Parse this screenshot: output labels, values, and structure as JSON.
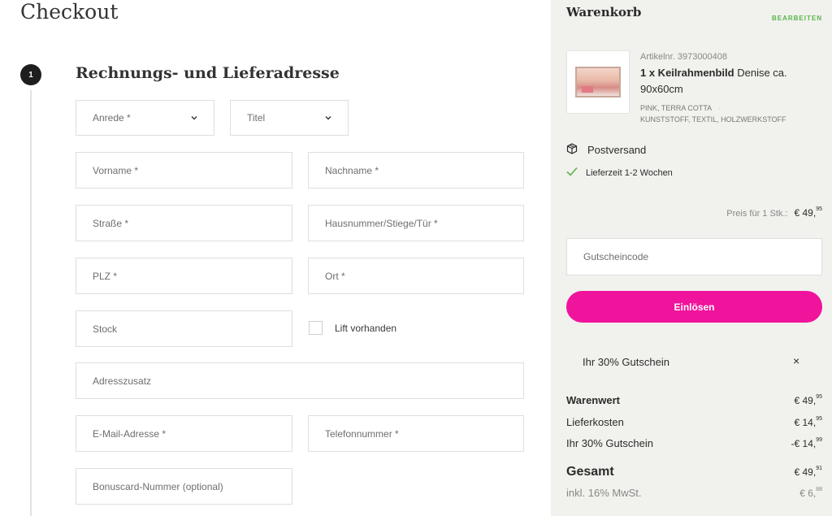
{
  "page": {
    "title": "Checkout"
  },
  "step": {
    "number": "1",
    "title": "Rechnungs- und Lieferadresse"
  },
  "form": {
    "salutation": "Anrede *",
    "title": "Titel",
    "first_name": "Vorname *",
    "last_name": "Nachname *",
    "street": "Straße *",
    "house_number": "Hausnummer/Stiege/Tür *",
    "zip": "PLZ *",
    "city": "Ort *",
    "floor": "Stock",
    "elevator_label": "Lift vorhanden",
    "address_extra": "Adresszusatz",
    "email": "E-Mail-Adresse *",
    "phone": "Telefonnummer *",
    "bonuscard": "Bonuscard-Nummer (optional)"
  },
  "cart": {
    "title": "Warenkorb",
    "edit": "BEARBEITEN",
    "item": {
      "article_no": "Artikelnr. 3973000408",
      "qty_name": "1 x Keilrahmenbild",
      "name_rest": "Denise ca. 90x60cm",
      "attr_line1": "PINK, TERRA COTTA",
      "attr_sep": "·",
      "attr_line2": "KUNSTSTOFF, TEXTIL, HOLZWERKSTOFF"
    },
    "shipping": "Postversand",
    "delivery": "Lieferzeit 1-2 Wochen",
    "price_label": "Preis für 1 Stk.:",
    "price_main": "€ 49,",
    "price_cents": "95",
    "coupon_placeholder": "Gutscheincode",
    "redeem": "Einlösen",
    "applied_coupon": "Ihr 30% Gutschein",
    "remove": "×"
  },
  "summary": {
    "goods_label": "Warenwert",
    "goods_main": "€ 49,",
    "goods_cents": "95",
    "shipping_label": "Lieferkosten",
    "shipping_main": "€ 14,",
    "shipping_cents": "95",
    "coupon_label": "Ihr 30% Gutschein",
    "coupon_main": "-€ 14,",
    "coupon_cents": "99",
    "total_label": "Gesamt",
    "total_main": "€ 49,",
    "total_cents": "91",
    "vat_label": "inkl. 16% MwSt.",
    "vat_main": "€ 6,",
    "vat_cents": "88"
  },
  "colors": {
    "accent": "#f0139b",
    "edit_link": "#59b54a",
    "check": "#59b54a",
    "cart_bg": "#f1f1ed"
  },
  "icons": {
    "chevron": "chevron-down-icon",
    "box": "package-icon",
    "check": "check-icon",
    "close": "close-icon"
  }
}
